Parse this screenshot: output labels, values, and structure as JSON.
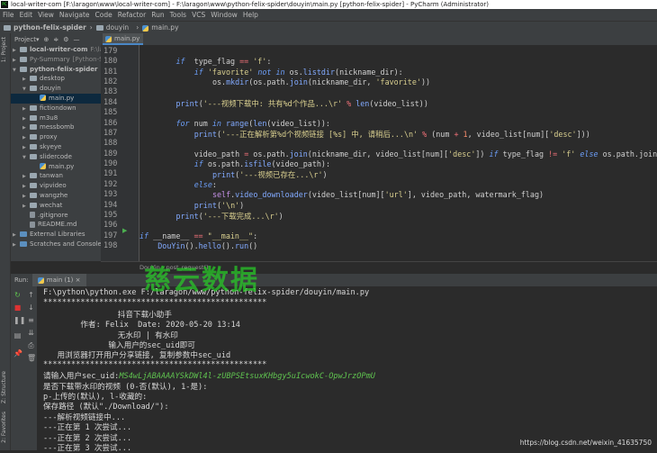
{
  "window": {
    "title": "local-writer-com [F:\\laragon\\www\\local-writer-com] - F:\\laragon\\www\\python-felix-spider\\douyin\\main.py [python-felix-spider] - PyCharm (Administrator)"
  },
  "menu": [
    "File",
    "Edit",
    "View",
    "Navigate",
    "Code",
    "Refactor",
    "Run",
    "Tools",
    "VCS",
    "Window",
    "Help"
  ],
  "breadcrumb": [
    "python-felix-spider",
    "douyin",
    "main.py"
  ],
  "project_panel": {
    "label": "Project",
    "side_tab": "1: Project"
  },
  "editor_tab": "main.py",
  "tree": [
    {
      "label": "local-writer-com",
      "hint": "F:\\larago",
      "depth": 0,
      "type": "folder",
      "arrow": "▶",
      "bold": true
    },
    {
      "label": "Py-Summary",
      "hint": "[Python-Sum",
      "depth": 0,
      "type": "folder",
      "arrow": "▶"
    },
    {
      "label": "python-felix-spider",
      "hint": "F:\\lar",
      "depth": 0,
      "type": "folder",
      "arrow": "▼",
      "bold": true
    },
    {
      "label": "desktop",
      "depth": 1,
      "type": "folder",
      "arrow": "▶"
    },
    {
      "label": "douyin",
      "depth": 1,
      "type": "folder",
      "arrow": "▼"
    },
    {
      "label": "main.py",
      "depth": 2,
      "type": "py",
      "selected": true
    },
    {
      "label": "fictiondown",
      "depth": 1,
      "type": "folder",
      "arrow": "▶"
    },
    {
      "label": "m3u8",
      "depth": 1,
      "type": "folder",
      "arrow": "▶"
    },
    {
      "label": "messbomb",
      "depth": 1,
      "type": "folder",
      "arrow": "▶"
    },
    {
      "label": "proxy",
      "depth": 1,
      "type": "folder",
      "arrow": "▶"
    },
    {
      "label": "skyeye",
      "depth": 1,
      "type": "folder",
      "arrow": "▶"
    },
    {
      "label": "slidercode",
      "depth": 1,
      "type": "folder",
      "arrow": "▼"
    },
    {
      "label": "main.py",
      "depth": 2,
      "type": "py"
    },
    {
      "label": "tanwan",
      "depth": 1,
      "type": "folder",
      "arrow": "▶"
    },
    {
      "label": "vipvideo",
      "depth": 1,
      "type": "folder",
      "arrow": "▶"
    },
    {
      "label": "wangzhe",
      "depth": 1,
      "type": "folder",
      "arrow": "▶"
    },
    {
      "label": "wechat",
      "depth": 1,
      "type": "folder",
      "arrow": "▶"
    },
    {
      "label": ".gitignore",
      "depth": 1,
      "type": "file"
    },
    {
      "label": "README.md",
      "depth": 1,
      "type": "file"
    },
    {
      "label": "External Libraries",
      "depth": 0,
      "type": "lib",
      "arrow": "▶"
    },
    {
      "label": "Scratches and Consoles",
      "depth": 0,
      "type": "lib",
      "arrow": "▶"
    }
  ],
  "code": [
    {
      "n": "179",
      "i": 0,
      "t": []
    },
    {
      "n": "180",
      "i": 8,
      "t": [
        [
          "kw",
          "if"
        ],
        [
          "",
          "  type_flag "
        ],
        [
          "op",
          "=="
        ],
        [
          "st",
          " 'f'"
        ],
        [
          "",
          ":"
        ]
      ]
    },
    {
      "n": "181",
      "i": 12,
      "t": [
        [
          "kw",
          "if"
        ],
        [
          "st",
          " 'favorite'"
        ],
        [
          "kw",
          " not in"
        ],
        [
          "",
          " os."
        ],
        [
          "fn",
          "listdir"
        ],
        [
          "",
          "(nickname_dir):"
        ]
      ]
    },
    {
      "n": "182",
      "i": 16,
      "t": [
        [
          "",
          "os."
        ],
        [
          "fn",
          "mkdir"
        ],
        [
          "",
          "(os.path."
        ],
        [
          "fn",
          "join"
        ],
        [
          "",
          "(nickname_dir, "
        ],
        [
          "st",
          "'favorite'"
        ],
        [
          "",
          "))"
        ]
      ]
    },
    {
      "n": "183",
      "i": 0,
      "t": []
    },
    {
      "n": "184",
      "i": 8,
      "t": [
        [
          "fn",
          "print"
        ],
        [
          "",
          "("
        ],
        [
          "st",
          "'---视频下载中: 共有%d个作品...\\r'"
        ],
        [
          "op",
          " %"
        ],
        [
          "fn",
          " len"
        ],
        [
          "",
          "(video_list))"
        ]
      ]
    },
    {
      "n": "185",
      "i": 0,
      "t": []
    },
    {
      "n": "186",
      "i": 8,
      "t": [
        [
          "kw",
          "for"
        ],
        [
          "",
          " num "
        ],
        [
          "kw",
          "in"
        ],
        [
          "fn",
          " range"
        ],
        [
          "",
          "("
        ],
        [
          "fn",
          "len"
        ],
        [
          "",
          "(video_list)):"
        ]
      ]
    },
    {
      "n": "187",
      "i": 12,
      "t": [
        [
          "fn",
          "print"
        ],
        [
          "",
          "("
        ],
        [
          "st",
          "'---正在解析第%d个视频链接 [%s] 中, 请稍后...\\n'"
        ],
        [
          "op",
          " %"
        ],
        [
          "",
          " (num "
        ],
        [
          "op",
          "+"
        ],
        [
          "nm",
          " 1"
        ],
        [
          "",
          ", video_list[num]["
        ],
        [
          "st",
          "'desc'"
        ],
        [
          "",
          "]))"
        ]
      ]
    },
    {
      "n": "188",
      "i": 0,
      "t": []
    },
    {
      "n": "189",
      "i": 12,
      "t": [
        [
          "",
          "video_path "
        ],
        [
          "op",
          "="
        ],
        [
          "",
          " os.path."
        ],
        [
          "fn",
          "join"
        ],
        [
          "",
          "(nickname_dir, video_list[num]["
        ],
        [
          "st",
          "'desc'"
        ],
        [
          "",
          "]) "
        ],
        [
          "kw",
          "if"
        ],
        [
          "",
          " type_flag "
        ],
        [
          "op",
          "!="
        ],
        [
          "st",
          " 'f'"
        ],
        [
          "kw",
          " else"
        ],
        [
          "",
          " os.path.join"
        ]
      ]
    },
    {
      "n": "190",
      "i": 12,
      "t": [
        [
          "kw",
          "if"
        ],
        [
          "",
          " os.path."
        ],
        [
          "fn",
          "isfile"
        ],
        [
          "",
          "(video_path):"
        ]
      ]
    },
    {
      "n": "191",
      "i": 16,
      "t": [
        [
          "fn",
          "print"
        ],
        [
          "",
          "("
        ],
        [
          "st",
          "'---视频已存在...\\r'"
        ],
        [
          "",
          ")"
        ]
      ]
    },
    {
      "n": "192",
      "i": 12,
      "t": [
        [
          "kw",
          "else"
        ],
        [
          "",
          ":"
        ]
      ]
    },
    {
      "n": "193",
      "i": 16,
      "t": [
        [
          "sf",
          "self"
        ],
        [
          "",
          "."
        ],
        [
          "fn",
          "video_downloader"
        ],
        [
          "",
          "(video_list[num]["
        ],
        [
          "st",
          "'url'"
        ],
        [
          "",
          "], video_path, watermark_flag)"
        ]
      ]
    },
    {
      "n": "194",
      "i": 12,
      "t": [
        [
          "fn",
          "print"
        ],
        [
          "",
          "("
        ],
        [
          "st",
          "'\\n'"
        ],
        [
          "",
          ")"
        ]
      ]
    },
    {
      "n": "195",
      "i": 8,
      "t": [
        [
          "fn",
          "print"
        ],
        [
          "",
          "("
        ],
        [
          "st",
          "'---下载完成...\\r'"
        ],
        [
          "",
          ")"
        ]
      ]
    },
    {
      "n": "196",
      "i": 0,
      "t": []
    },
    {
      "n": "197",
      "i": 0,
      "t": [
        [
          "kw",
          "if"
        ],
        [
          "",
          " __name__ "
        ],
        [
          "op",
          "=="
        ],
        [
          "st",
          " \"__main__\""
        ],
        [
          "",
          ":"
        ]
      ]
    },
    {
      "n": "198",
      "i": 4,
      "t": [
        [
          "fn",
          "DouYin"
        ],
        [
          "",
          "()."
        ],
        [
          "fn",
          "hello"
        ],
        [
          "",
          "()."
        ],
        [
          "fn",
          "run"
        ],
        [
          "",
          "()"
        ]
      ]
    }
  ],
  "editor_breadcrumb": [
    "DouYin",
    "post_request()"
  ],
  "run": {
    "label": "Run:",
    "tab": "main (1)"
  },
  "console": [
    "F:\\python\\python.exe F:/laragon/www/python-felix-spider/douyin/main.py",
    "************************************************",
    "                抖音下载小助手",
    "        作者: Felix  Date: 2020-05-20 13:14",
    "                无水印 | 有水印",
    "              输入用户的sec_uid即可",
    "   用浏览器打开用户分享链接, 复制参数中sec_uid",
    "************************************************",
    "请输入用户sec_uid:",
    "是否下载带水印的视频 (0-否(默认), 1-是):",
    "p-上传的(默认), l-收藏的:",
    "保存路径 (默认\"./Download/\"):",
    "---解析视频链接中...",
    "---正在第 1 次尝试...",
    "---正在第 2 次尝试...",
    "---正在第 3 次尝试..."
  ],
  "console_input": "MS4wLjABAAAAYSkDWl4l-zUBPSEtsuxKHbgy5uIcwokC-OpwJrzOPmU",
  "side_tabs": {
    "structure": "Z: Structure",
    "favorites": "2: Favorites"
  },
  "watermark": "慈云数据",
  "csdn": "https://blog.csdn.net/weixin_41635750",
  "colors": {
    "keyword": "#6c9ef8",
    "string": "#d9cf8f",
    "input": "#5fc24f",
    "selection": "#0d293e"
  }
}
